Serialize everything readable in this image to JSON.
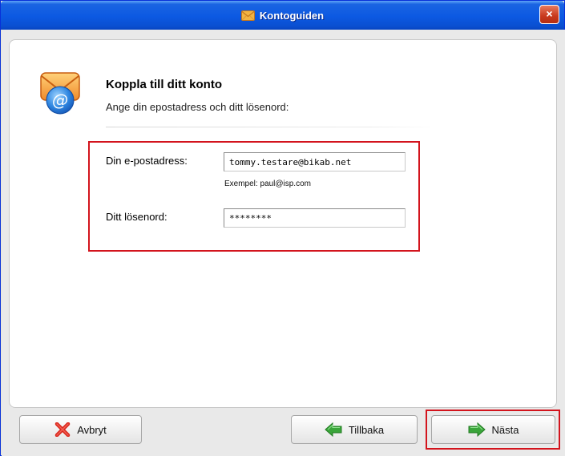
{
  "window": {
    "title": "Kontoguiden",
    "close_glyph": "×"
  },
  "header": {
    "heading": "Koppla till ditt konto",
    "subheading": "Ange din epostadress och ditt lösenord:"
  },
  "form": {
    "email_label": "Din e-postadress:",
    "email_value": "tommy.testare@bikab.net",
    "email_example": "Exempel: paul@isp.com",
    "password_label": "Ditt lösenord:",
    "password_value": "********"
  },
  "buttons": {
    "cancel_label": "Avbryt",
    "back_label": "Tillbaka",
    "next_label": "Nästa"
  },
  "icons": {
    "title": "envelope-icon",
    "header": "mail-at-icon",
    "cancel": "red-x-icon",
    "back": "green-arrow-left-icon",
    "next": "green-arrow-right-icon",
    "close": "close-icon"
  },
  "colors": {
    "titlebar": "#0c59e2",
    "highlight": "#d3141d",
    "arrow": "#3aa53a"
  }
}
